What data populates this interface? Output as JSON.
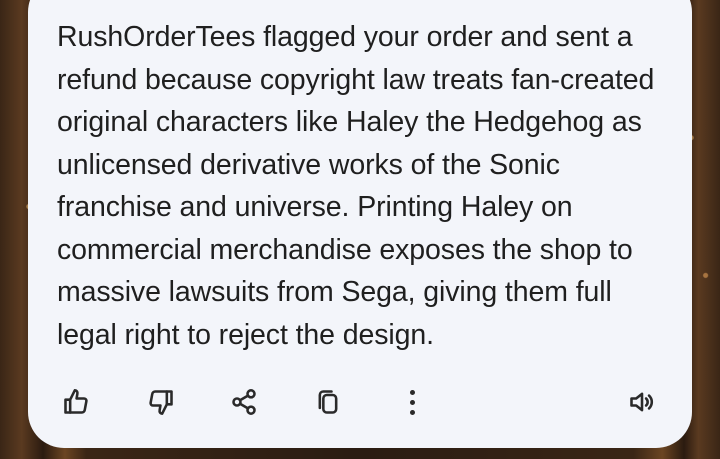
{
  "message": {
    "text": "RushOrderTees flagged your order and sent a refund because copyright law treats fan-created original characters like Haley the Hedgehog as unlicensed derivative works of the Sonic franchise and universe. Printing Haley on commercial merchandise exposes the shop to massive lawsuits from Sega, giving them full legal right to reject the design."
  },
  "actions": [
    {
      "icon": "thumbs-up-icon"
    },
    {
      "icon": "thumbs-down-icon"
    },
    {
      "icon": "share-icon"
    },
    {
      "icon": "copy-icon"
    },
    {
      "icon": "more-vert-icon"
    },
    {
      "icon": "speaker-icon"
    }
  ],
  "colors": {
    "card_background": "#f3f5fa",
    "text": "#1f1f1f",
    "icon": "#2a2a2a"
  }
}
